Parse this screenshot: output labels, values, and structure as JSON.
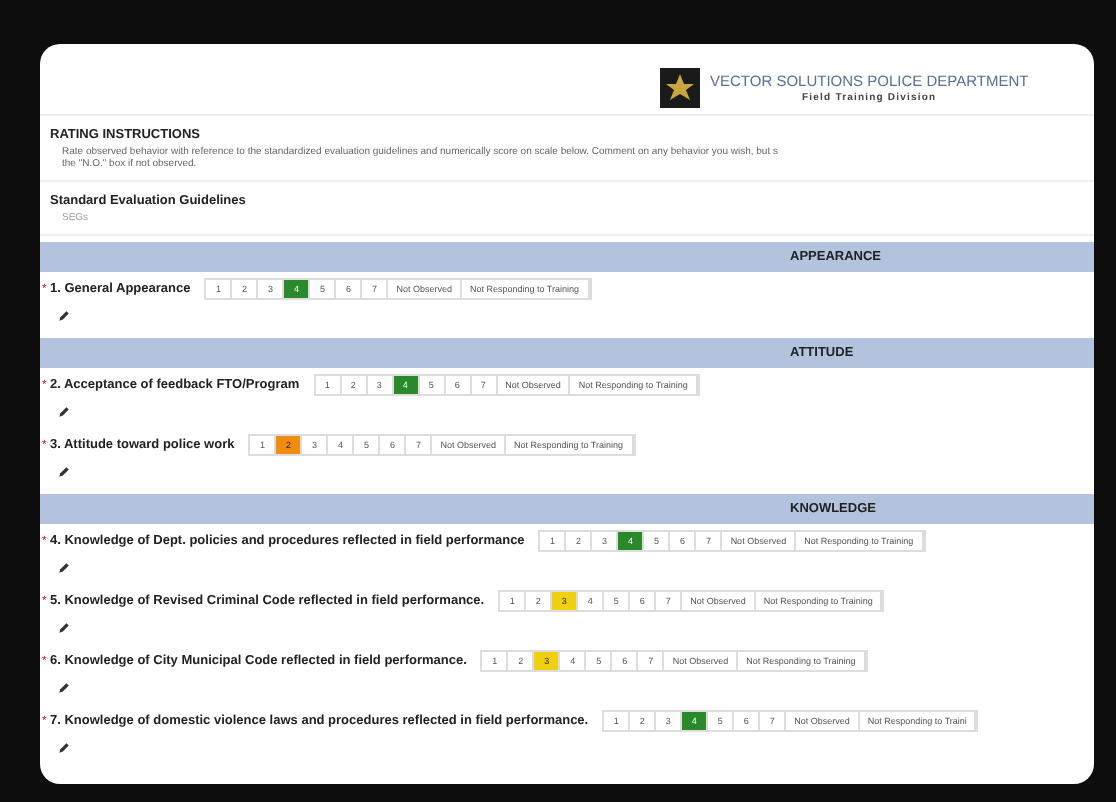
{
  "header": {
    "title": "VECTOR SOLUTIONS POLICE DEPARTMENT",
    "subtitle": "Field Training Division"
  },
  "instructions": {
    "title": "RATING INSTRUCTIONS",
    "lines": [
      "Rate observed behavior with reference to the standardized evaluation guidelines and numerically score on scale below. Comment on any behavior you wish, but s",
      "the \"N.O.\" box if not observed."
    ]
  },
  "guidelines": {
    "title": "Standard Evaluation Guidelines",
    "value": "SEGs"
  },
  "sections": [
    {
      "title": "APPEARANCE",
      "items": [
        {
          "required": "*",
          "label": "1. General Appearance",
          "color": "#2a8a2a",
          "options": [
            {
              "label": "1",
              "selected": false
            },
            {
              "label": "2",
              "selected": false
            },
            {
              "label": "3",
              "selected": false
            },
            {
              "label": "4",
              "selected": true
            },
            {
              "label": "5",
              "selected": false
            },
            {
              "label": "6",
              "selected": false
            },
            {
              "label": "7",
              "selected": false
            },
            {
              "label": "Not Observed",
              "selected": false
            },
            {
              "label": "Not Responding to Training",
              "selected": false
            }
          ]
        }
      ]
    },
    {
      "title": "ATTITUDE",
      "items": [
        {
          "required": "*",
          "label": "2. Acceptance of feedback FTO/Program",
          "color": "#2a8a2a",
          "options": [
            {
              "label": "1",
              "selected": false
            },
            {
              "label": "2",
              "selected": false
            },
            {
              "label": "3",
              "selected": false
            },
            {
              "label": "4",
              "selected": true
            },
            {
              "label": "5",
              "selected": false
            },
            {
              "label": "6",
              "selected": false
            },
            {
              "label": "7",
              "selected": false
            },
            {
              "label": "Not Observed",
              "selected": false
            },
            {
              "label": "Not Responding to Training",
              "selected": false
            }
          ]
        },
        {
          "required": "*",
          "label": "3. Attitude toward police work",
          "color": "#f08c10",
          "options": [
            {
              "label": "1",
              "selected": false
            },
            {
              "label": "2",
              "selected": true
            },
            {
              "label": "3",
              "selected": false
            },
            {
              "label": "4",
              "selected": false
            },
            {
              "label": "5",
              "selected": false
            },
            {
              "label": "6",
              "selected": false
            },
            {
              "label": "7",
              "selected": false
            },
            {
              "label": "Not Observed",
              "selected": false
            },
            {
              "label": "Not Responding to Training",
              "selected": false
            }
          ]
        }
      ]
    },
    {
      "title": "KNOWLEDGE",
      "items": [
        {
          "required": "*",
          "label": "4. Knowledge of Dept. policies and procedures reflected in field performance",
          "color": "#2a8a2a",
          "options": [
            {
              "label": "1",
              "selected": false
            },
            {
              "label": "2",
              "selected": false
            },
            {
              "label": "3",
              "selected": false
            },
            {
              "label": "4",
              "selected": true
            },
            {
              "label": "5",
              "selected": false
            },
            {
              "label": "6",
              "selected": false
            },
            {
              "label": "7",
              "selected": false
            },
            {
              "label": "Not Observed",
              "selected": false
            },
            {
              "label": "Not Responding to Training",
              "selected": false
            }
          ]
        },
        {
          "required": "*",
          "label": "5. Knowledge of Revised Criminal Code reflected in field performance.",
          "color": "#f0d010",
          "options": [
            {
              "label": "1",
              "selected": false
            },
            {
              "label": "2",
              "selected": false
            },
            {
              "label": "3",
              "selected": true
            },
            {
              "label": "4",
              "selected": false
            },
            {
              "label": "5",
              "selected": false
            },
            {
              "label": "6",
              "selected": false
            },
            {
              "label": "7",
              "selected": false
            },
            {
              "label": "Not Observed",
              "selected": false
            },
            {
              "label": "Not Responding to Training",
              "selected": false
            }
          ]
        },
        {
          "required": "*",
          "label": "6. Knowledge of City Municipal Code reflected in field performance.",
          "color": "#f0d010",
          "options": [
            {
              "label": "1",
              "selected": false
            },
            {
              "label": "2",
              "selected": false
            },
            {
              "label": "3",
              "selected": true
            },
            {
              "label": "4",
              "selected": false
            },
            {
              "label": "5",
              "selected": false
            },
            {
              "label": "6",
              "selected": false
            },
            {
              "label": "7",
              "selected": false
            },
            {
              "label": "Not Observed",
              "selected": false
            },
            {
              "label": "Not Responding to Training",
              "selected": false
            }
          ]
        },
        {
          "required": "*",
          "label": "7. Knowledge of domestic violence laws and procedures reflected in field performance.",
          "color": "#2a8a2a",
          "options": [
            {
              "label": "1",
              "selected": false
            },
            {
              "label": "2",
              "selected": false
            },
            {
              "label": "3",
              "selected": false
            },
            {
              "label": "4",
              "selected": true
            },
            {
              "label": "5",
              "selected": false
            },
            {
              "label": "6",
              "selected": false
            },
            {
              "label": "7",
              "selected": false
            },
            {
              "label": "Not Observed",
              "selected": false
            },
            {
              "label": "Not Responding to Traini",
              "selected": false
            }
          ]
        }
      ]
    }
  ]
}
